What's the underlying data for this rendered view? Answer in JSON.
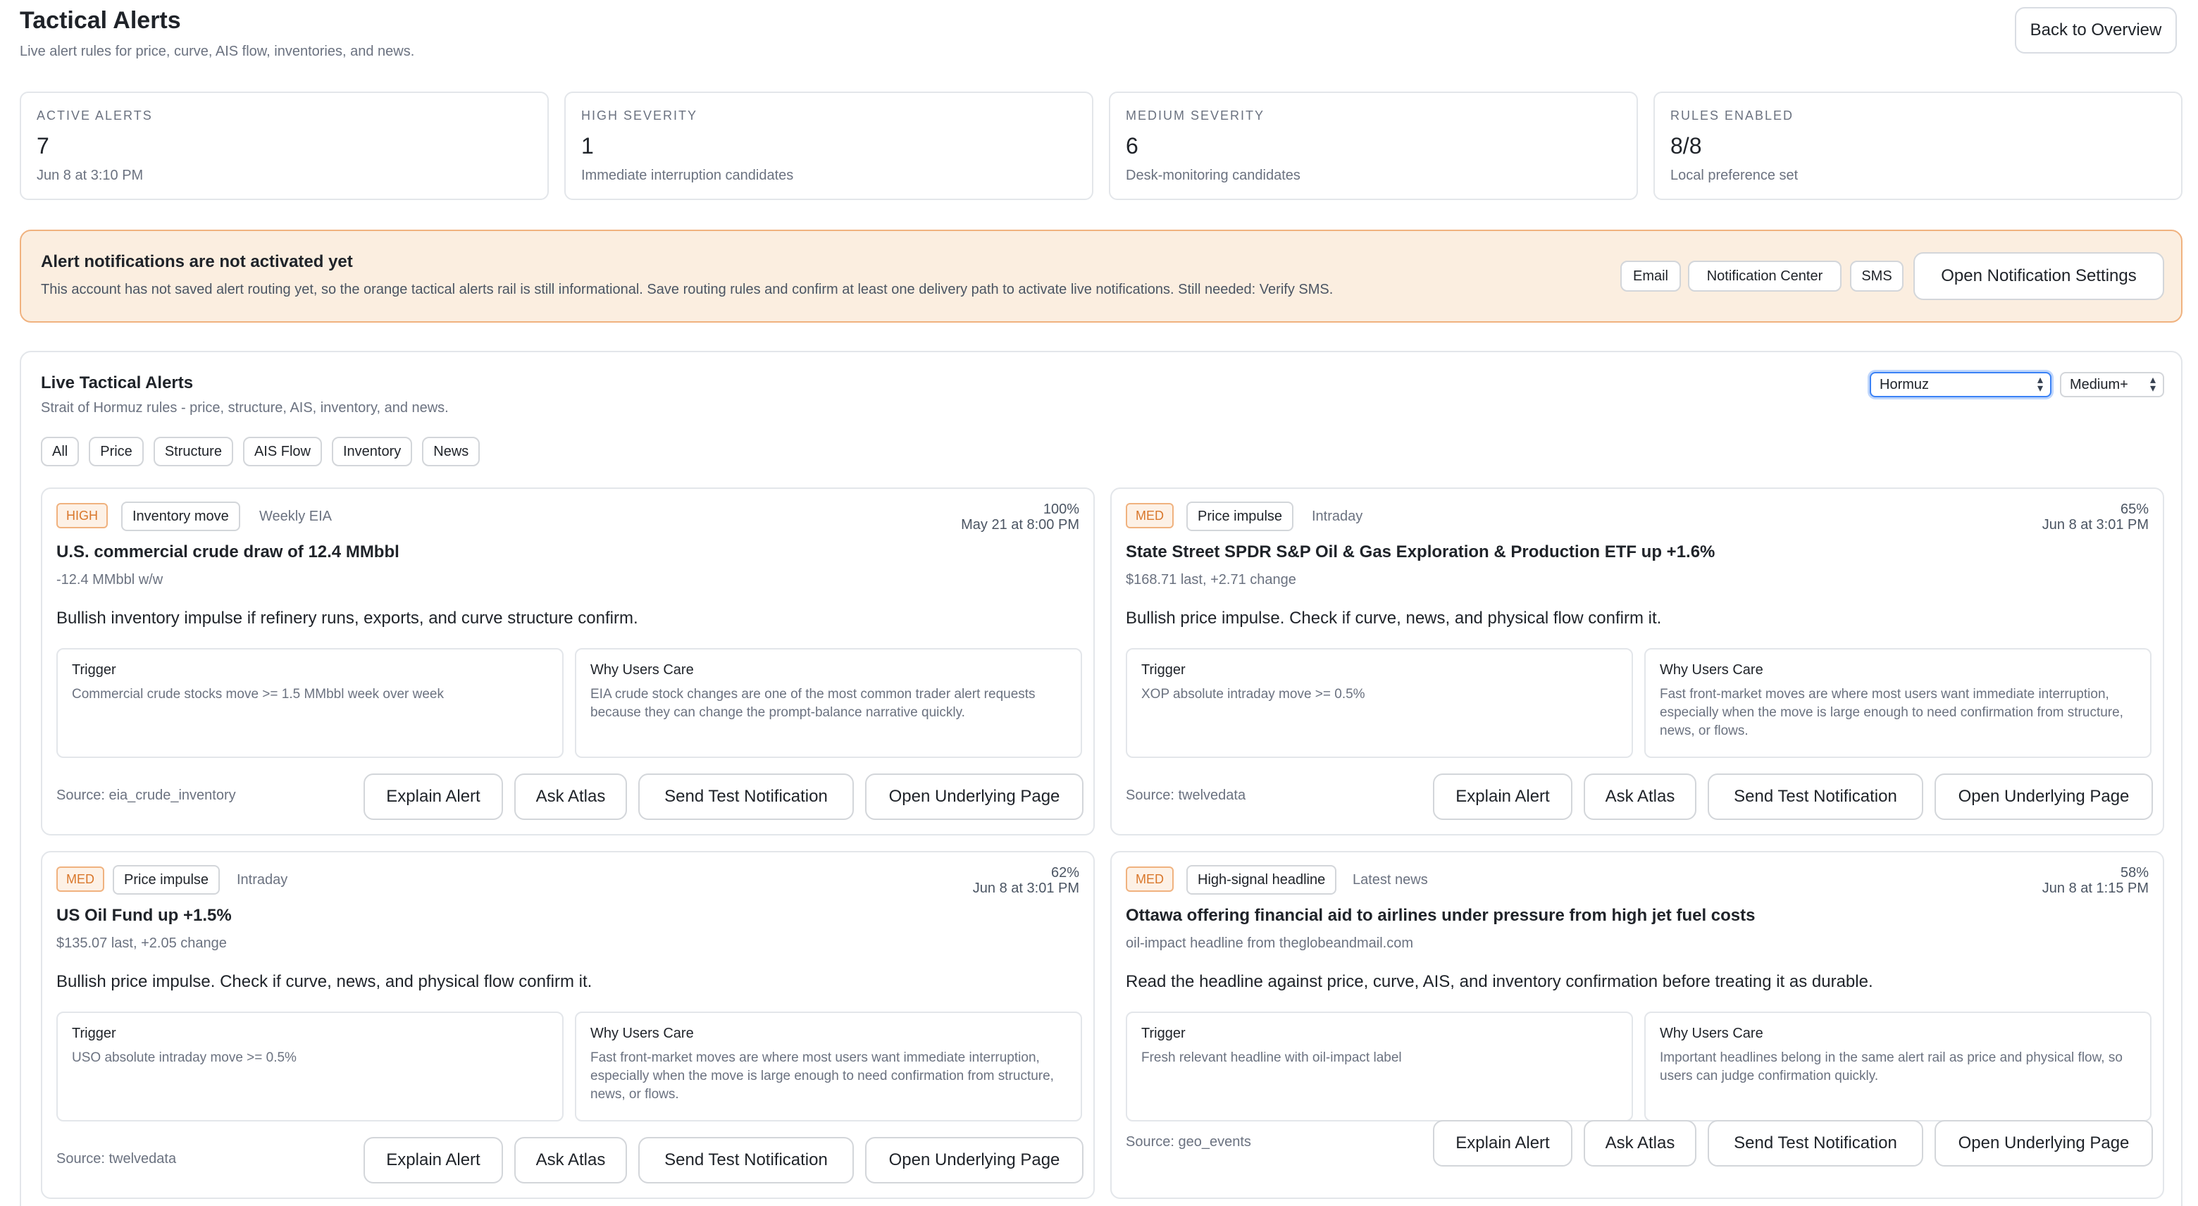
{
  "header": {
    "title": "Tactical Alerts",
    "subtitle": "Live alert rules for price, curve, AIS flow, inventories, and news.",
    "back_label": "Back to Overview"
  },
  "stats": [
    {
      "label": "ACTIVE ALERTS",
      "value": "7",
      "note": "Jun 8 at 3:10 PM"
    },
    {
      "label": "HIGH SEVERITY",
      "value": "1",
      "note": "Immediate interruption candidates"
    },
    {
      "label": "MEDIUM SEVERITY",
      "value": "6",
      "note": "Desk-monitoring candidates"
    },
    {
      "label": "RULES ENABLED",
      "value": "8/8",
      "note": "Local preference set"
    }
  ],
  "banner": {
    "title": "Alert notifications are not activated yet",
    "text": "This account has not saved alert routing yet, so the orange tactical alerts rail is still informational. Save routing rules and confirm at least one delivery path to activate live notifications. Still needed: Verify SMS.",
    "channels": [
      "Email",
      "Notification Center",
      "SMS"
    ],
    "button_label": "Open Notification Settings",
    "accent": "#f0b27f",
    "background": "#fbeee0"
  },
  "panel": {
    "title": "Live Tactical Alerts",
    "subtitle": "Strait of Hormuz rules - price, structure, AIS, inventory, and news.",
    "region_select": "Hormuz",
    "severity_select": "Medium+",
    "filters": [
      "All",
      "Price",
      "Structure",
      "AIS Flow",
      "Inventory",
      "News"
    ]
  },
  "labels": {
    "trigger": "Trigger",
    "why": "Why Users Care",
    "explain": "Explain Alert",
    "ask": "Ask Atlas",
    "test": "Send Test Notification",
    "open": "Open Underlying Page"
  },
  "alerts": [
    {
      "severity": "HIGH",
      "category": "Inventory move",
      "frequency": "Weekly EIA",
      "confidence": "100%",
      "time": "May 21 at 8:00 PM",
      "title": "U.S. commercial crude draw of 12.4 MMbbl",
      "metric": "-12.4 MMbbl w/w",
      "description": "Bullish inventory impulse if refinery runs, exports, and curve structure confirm.",
      "trigger": "Commercial crude stocks move >= 1.5 MMbbl week over week",
      "why": "EIA crude stock changes are one of the most common trader alert requests because they can change the prompt-balance narrative quickly.",
      "source": "Source: eia_crude_inventory"
    },
    {
      "severity": "MED",
      "category": "Price impulse",
      "frequency": "Intraday",
      "confidence": "65%",
      "time": "Jun 8 at 3:01 PM",
      "title": "State Street SPDR S&P Oil & Gas Exploration & Production ETF up +1.6%",
      "metric": "$168.71 last, +2.71 change",
      "description": "Bullish price impulse. Check if curve, news, and physical flow confirm it.",
      "trigger": "XOP absolute intraday move >= 0.5%",
      "why": "Fast front-market moves are where most users want immediate interruption, especially when the move is large enough to need confirmation from structure, news, or flows.",
      "source": "Source: twelvedata"
    },
    {
      "severity": "MED",
      "category": "Price impulse",
      "frequency": "Intraday",
      "confidence": "62%",
      "time": "Jun 8 at 3:01 PM",
      "title": "US Oil Fund up +1.5%",
      "metric": "$135.07 last, +2.05 change",
      "description": "Bullish price impulse. Check if curve, news, and physical flow confirm it.",
      "trigger": "USO absolute intraday move >= 0.5%",
      "why": "Fast front-market moves are where most users want immediate interruption, especially when the move is large enough to need confirmation from structure, news, or flows.",
      "source": "Source: twelvedata"
    },
    {
      "severity": "MED",
      "category": "High-signal headline",
      "frequency": "Latest news",
      "confidence": "58%",
      "time": "Jun 8 at 1:15 PM",
      "title": "Ottawa offering financial aid to airlines under pressure from high jet fuel costs",
      "metric": "oil-impact headline from theglobeandmail.com",
      "description": "Read the headline against price, curve, AIS, and inventory confirmation before treating it as durable.",
      "trigger": "Fresh relevant headline with oil-impact label",
      "why": "Important headlines belong in the same alert rail as price and physical flow, so users can judge confirmation quickly.",
      "source": "Source: geo_events"
    }
  ]
}
